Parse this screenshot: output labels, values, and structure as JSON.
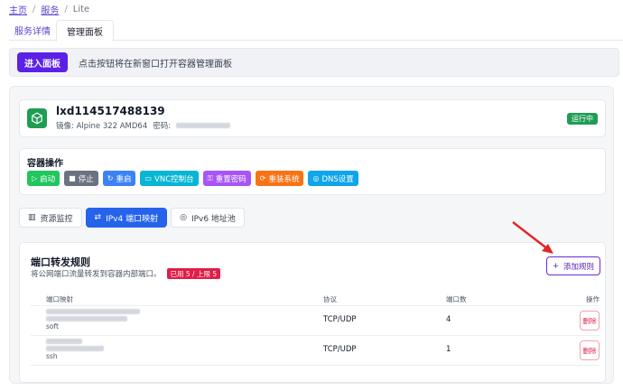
{
  "breadcrumb": {
    "home": "主页",
    "services": "服务",
    "current": "Lite"
  },
  "tabs": {
    "details": "服务详情",
    "panel": "管理面板"
  },
  "notice": {
    "button": "进入面板",
    "text": "点击按钮将在新窗口打开容器管理面板"
  },
  "server": {
    "name": "lxd114517488139",
    "image_label": "镜像: Alpine 322 AMD64",
    "password_label": "密码:",
    "status": "运行中"
  },
  "operations": {
    "title": "容器操作",
    "buttons": [
      {
        "label": "启动",
        "color": "#22c55e",
        "icon": "play-icon"
      },
      {
        "label": "停止",
        "color": "#6b7280",
        "icon": "stop-icon"
      },
      {
        "label": "重启",
        "color": "#3b82f6",
        "icon": "restart-icon"
      },
      {
        "label": "VNC控制台",
        "color": "#06b6d4",
        "icon": "monitor-icon"
      },
      {
        "label": "重置密码",
        "color": "#a855f7",
        "icon": "key-icon"
      },
      {
        "label": "重装系统",
        "color": "#f97316",
        "icon": "refresh-icon"
      },
      {
        "label": "DNS设置",
        "color": "#0ea5e9",
        "icon": "globe-icon"
      }
    ]
  },
  "subtabs": {
    "monitor": "资源监控",
    "ipv4": "IPv4 端口映射",
    "ipv6": "IPv6 地址池"
  },
  "rules": {
    "title": "端口转发规则",
    "description": "将公网端口流量转发到容器内部端口。",
    "quota": "已用 5 / 上限 5",
    "add_button": "添加规则",
    "columns": {
      "mapping": "端口映射",
      "protocol": "协议",
      "count": "端口数",
      "action": "操作"
    },
    "rows": [
      {
        "tag": "soft",
        "protocol": "TCP/UDP",
        "count": "4",
        "action": "删除"
      },
      {
        "tag": "ssh",
        "protocol": "TCP/UDP",
        "count": "1",
        "action": "删除"
      }
    ]
  },
  "colors": {
    "accent": "#5b21e6",
    "running": "#1f9d55",
    "danger": "#e11d48",
    "active_tab": "#2563eb"
  }
}
